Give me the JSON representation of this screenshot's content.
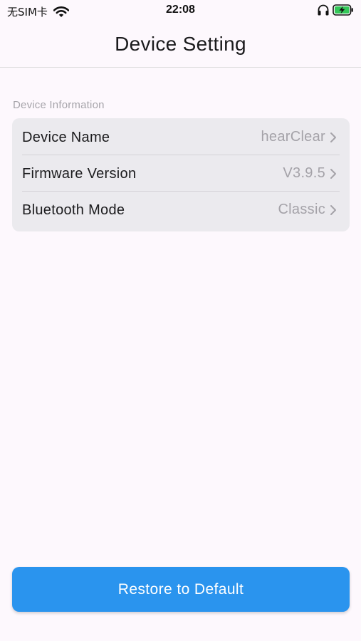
{
  "status_bar": {
    "carrier": "无SIM卡",
    "time": "22:08",
    "icons": [
      "wifi-icon",
      "headphone-icon",
      "battery-charging-icon"
    ]
  },
  "header": {
    "title": "Device Setting"
  },
  "device_info": {
    "section_title": "Device Information",
    "rows": [
      {
        "label": "Device Name",
        "value": "hearClear"
      },
      {
        "label": "Firmware Version",
        "value": "V3.9.5"
      },
      {
        "label": "Bluetooth Mode",
        "value": "Classic"
      }
    ]
  },
  "footer": {
    "restore_label": "Restore to Default"
  },
  "colors": {
    "background": "#fdf8fd",
    "card": "#ebeaee",
    "accent": "#2a94ee",
    "battery": "#34c759"
  }
}
